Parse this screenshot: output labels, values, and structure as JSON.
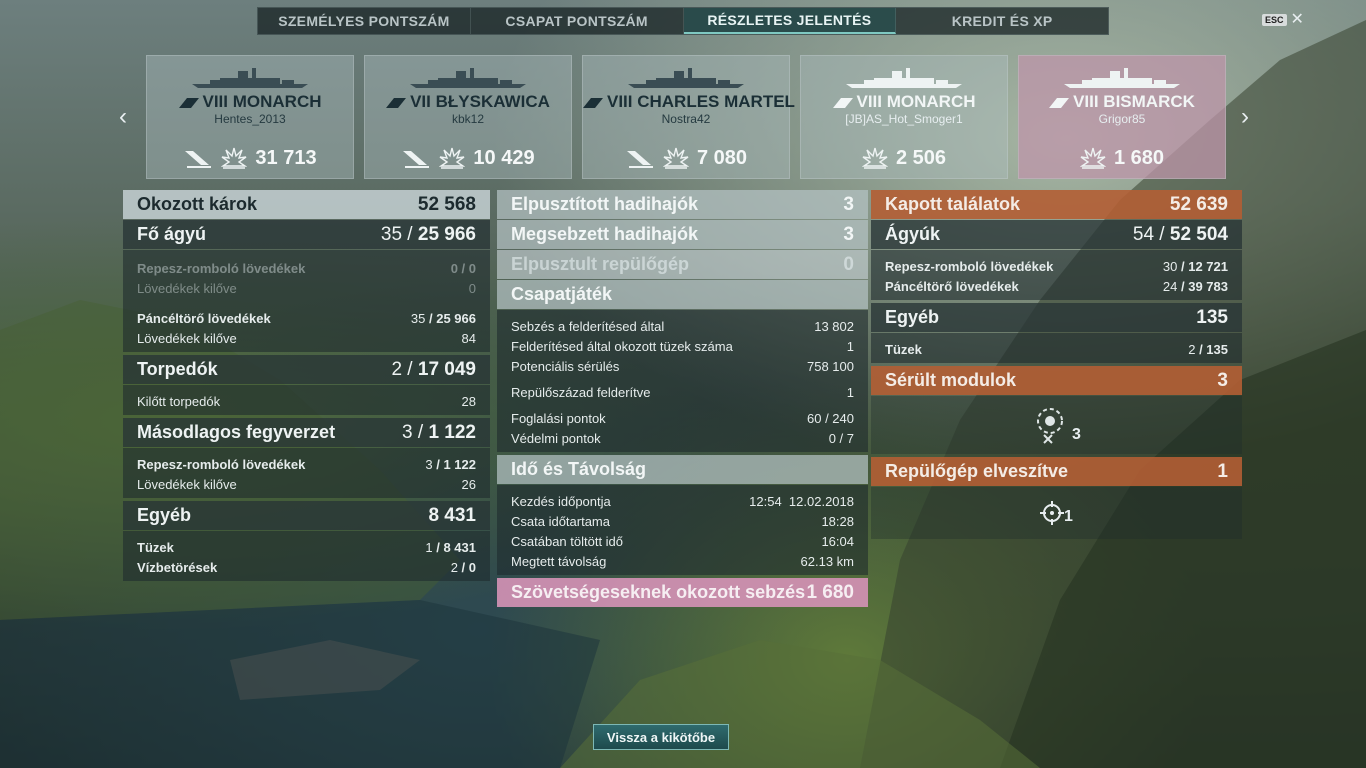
{
  "tabs": [
    {
      "label": "SZEMÉLYES PONTSZÁM"
    },
    {
      "label": "CSAPAT PONTSZÁM"
    },
    {
      "label": "RÉSZLETES JELENTÉS"
    },
    {
      "label": "KREDIT ÉS XP"
    }
  ],
  "active_tab": "RÉSZLETES JELENTÉS",
  "close": {
    "key": "ESC",
    "icon": "close-icon"
  },
  "ships": [
    {
      "name": "VIII MONARCH",
      "player": "Hentes_2013",
      "damage": "31 713",
      "sunk_icon": true,
      "type_icon": "battleship-icon"
    },
    {
      "name": "VII BŁYSKAWICA",
      "player": "kbk12",
      "damage": "10 429",
      "sunk_icon": true,
      "type_icon": "destroyer-icon"
    },
    {
      "name": "VIII CHARLES MARTEL",
      "player": "Nostra42",
      "damage": "7 080",
      "sunk_icon": true,
      "type_icon": "cruiser-icon"
    },
    {
      "name": "VIII MONARCH",
      "player": "[JB]AS_Hot_Smoger1",
      "damage": "2 506",
      "sunk_icon": false,
      "type_icon": "battleship-icon"
    },
    {
      "name": "VIII BISMARCK",
      "player": "Grigor85",
      "damage": "1 680",
      "sunk_icon": false,
      "type_icon": "battleship-icon"
    }
  ],
  "left": {
    "damage_dealt": {
      "label": "Okozott károk",
      "value": "52 568"
    },
    "main_battery": {
      "label": "Fő ágyú",
      "hits": "35",
      "total": "25 966"
    },
    "he_rows": [
      {
        "label": "Repesz-romboló lövedékek",
        "hits": "0",
        "total": "0"
      },
      {
        "label": "Lövedékek kilőve",
        "value": "0"
      }
    ],
    "ap_rows": [
      {
        "label": "Páncéltörő lövedékek",
        "hits": "35",
        "total": "25 966"
      },
      {
        "label": "Lövedékek kilőve",
        "value": "84"
      }
    ],
    "torpedoes": {
      "label": "Torpedók",
      "hits": "2",
      "total": "17 049"
    },
    "torp_rows": [
      {
        "label": "Kilőtt torpedók",
        "value": "28"
      }
    ],
    "secondary": {
      "label": "Másodlagos fegyverzet",
      "hits": "3",
      "total": "1 122"
    },
    "sec_rows": [
      {
        "label": "Repesz-romboló lövedékek",
        "hits": "3",
        "total": "1 122"
      },
      {
        "label": "Lövedékek kilőve",
        "value": "26"
      }
    ],
    "other": {
      "label": "Egyéb",
      "value": "8 431"
    },
    "other_rows": [
      {
        "label": "Tüzek",
        "hits": "1",
        "total": "8 431"
      },
      {
        "label": "Vízbetörések",
        "hits": "2",
        "total": "0"
      }
    ]
  },
  "middle": {
    "destroyed": {
      "label": "Elpusztított hadihajók",
      "value": "3"
    },
    "damaged": {
      "label": "Megsebzett hadihajók",
      "value": "3"
    },
    "planes": {
      "label": "Elpusztult repülőgép",
      "value": "0"
    },
    "teamplay": {
      "label": "Csapatjáték"
    },
    "team_rows": [
      {
        "label": "Sebzés a felderítésed által",
        "value": "13 802"
      },
      {
        "label": "Felderítésed által okozott tüzek száma",
        "value": "1"
      },
      {
        "label": "Potenciális sérülés",
        "value": "758 100"
      },
      {
        "label": "Repülőszázad felderítve",
        "value": "1"
      },
      {
        "label": "Foglalási pontok",
        "value": "60 / 240"
      },
      {
        "label": "Védelmi pontok",
        "value": "0 / 7"
      }
    ],
    "time": {
      "label": "Idő és Távolság"
    },
    "time_rows": [
      {
        "label": "Kezdés időpontja",
        "value": "12:54  12.02.2018"
      },
      {
        "label": "Csata időtartama",
        "value": "18:28"
      },
      {
        "label": "Csatában töltött idő",
        "value": "16:04"
      },
      {
        "label": "Megtett távolság",
        "value": "62.13 km"
      }
    ],
    "ally_damage": {
      "label": "Szövetségeseknek okozott sebzés",
      "value": "1 680"
    }
  },
  "right": {
    "received": {
      "label": "Kapott találatok",
      "value": "52 639"
    },
    "guns": {
      "label": "Ágyúk",
      "hits": "54",
      "total": "52 504"
    },
    "gun_rows": [
      {
        "label": "Repesz-romboló lövedékek",
        "hits": "30",
        "total": "12 721"
      },
      {
        "label": "Páncéltörő lövedékek",
        "hits": "24",
        "total": "39 783"
      }
    ],
    "other": {
      "label": "Egyéb",
      "value": "135"
    },
    "other_rows": [
      {
        "label": "Tüzek",
        "hits": "2",
        "total": "135"
      }
    ],
    "modules": {
      "label": "Sérült modulok",
      "value": "3"
    },
    "module_count": "3",
    "planes_lost": {
      "label": "Repülőgép elveszítve",
      "value": "1"
    },
    "plane_count": "1"
  },
  "back_button": "Vissza a kikötőbe"
}
